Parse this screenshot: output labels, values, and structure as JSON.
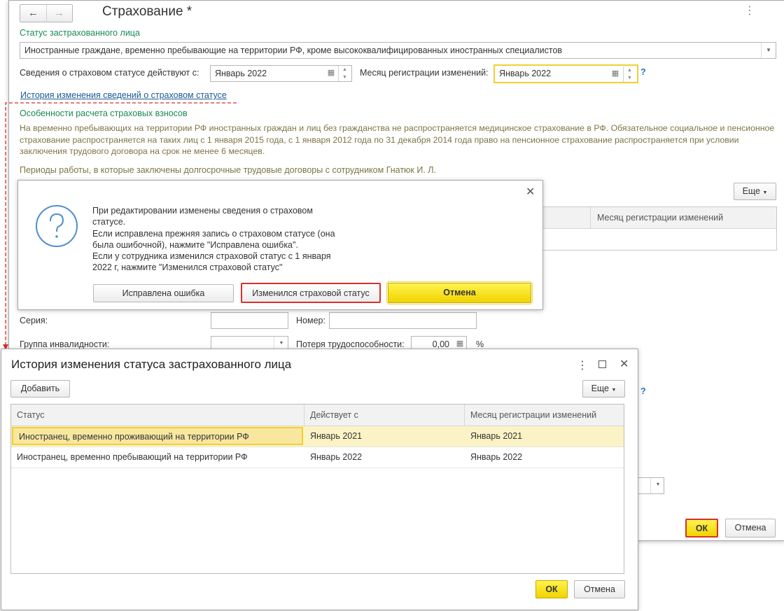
{
  "main": {
    "title": "Страхование *",
    "status_label": "Статус застрахованного лица",
    "status_value": "Иностранные граждане, временно пребывающие на территории РФ, кроме высококвалифицированных иностранных специалистов",
    "effective_label": "Сведения о страховом статусе действуют с:",
    "effective_value": "Январь 2022",
    "reg_month_label": "Месяц регистрации изменений:",
    "reg_month_value": "Январь 2022",
    "help": "?",
    "history_link": "История изменения сведений о страховом статусе",
    "features_title": "Особенности расчета страховых взносов",
    "features_text": "На временно пребывающих на территории РФ иностранных граждан и лиц без гражданства не распространяется медицинское страхование в РФ. Обязательное социальное и пенсионное страхование распространяется на таких лиц с 1 января 2015 года, с 1 января 2012 года по 31 декабря 2014 года право на пенсионное страхование распространяется при условии заключения трудового договора на срок не менее 6 месяцев.",
    "periods_text": "Периоды работы, в которые заключены долгосрочные трудовые договоры с сотрудником Гнатюк И. Л.",
    "more_label": "Еще",
    "col_reg_month": "Месяц регистрации изменений",
    "series_label": "Серия:",
    "number_label": "Номер:",
    "disability_label": "Группа инвалидности:",
    "loss_label": "Потеря трудоспособности:",
    "loss_value": "0,00",
    "percent": "%",
    "ok_label": "ОК",
    "cancel_label": "Отмена"
  },
  "dialog": {
    "message": [
      "При редактировании изменены сведения о страховом",
      "статусе.",
      "Если исправлена прежняя запись о страховом статусе (она",
      "была ошибочной), нажмите \"Исправлена ошибка\".",
      "Если у сотрудника изменился страховой статус с 1 января",
      "2022 г, нажмите \"Изменился страховой статус\""
    ],
    "btn_fixed": "Исправлена ошибка",
    "btn_changed": "Изменился страховой статус",
    "btn_cancel": "Отмена"
  },
  "history": {
    "title": "История изменения статуса застрахованного лица",
    "add_label": "Добавить",
    "more_label": "Еще",
    "columns": [
      "Статус",
      "Действует с",
      "Месяц регистрации изменений"
    ],
    "rows": [
      [
        "Иностранец, временно проживающий на территории РФ",
        "Январь 2021",
        "Январь 2021"
      ],
      [
        "Иностранец, временно пребывающий на территории РФ",
        "Январь 2022",
        "Январь 2022"
      ]
    ],
    "ok_label": "ОК",
    "cancel_label": "Отмена"
  },
  "colors": {
    "accent_yellow": "#f5d800",
    "highlight_row": "#fbf3c6",
    "green_text": "#1a8a52",
    "annotation_red": "#d9302c"
  }
}
